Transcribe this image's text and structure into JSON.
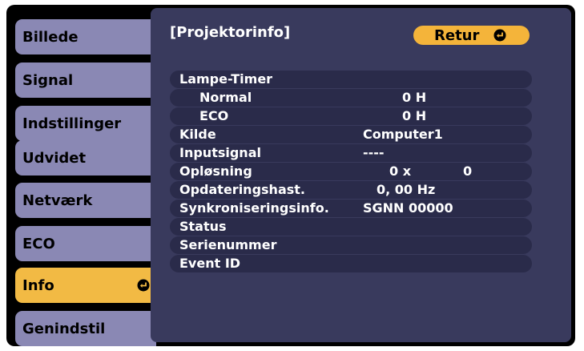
{
  "menu": {
    "items": [
      {
        "label": "Billede"
      },
      {
        "label": "Signal"
      },
      {
        "label": "Indstillinger"
      },
      {
        "label": "Udvidet"
      },
      {
        "label": "Netværk"
      },
      {
        "label": "ECO"
      },
      {
        "label": "Info",
        "selected": true
      },
      {
        "label": "Genindstil"
      }
    ],
    "selected_color": "#f2ba44",
    "tab_color": "#8a88b4"
  },
  "panel": {
    "title": "[Projektorinfo]",
    "return_label": "Retur",
    "return_icon": "enter-icon",
    "background": "#393a5d",
    "rows": [
      {
        "label": "Lampe-Timer",
        "value": "",
        "value2": ""
      },
      {
        "label": "Normal",
        "value": "0 H",
        "value2": ""
      },
      {
        "label": "ECO",
        "value": "0 H",
        "value2": ""
      },
      {
        "label": "Kilde",
        "value": "Computer1",
        "value2": ""
      },
      {
        "label": "Inputsignal",
        "value": "----",
        "value2": ""
      },
      {
        "label": "Opløsning",
        "value": "0 x",
        "value2": "0"
      },
      {
        "label": "Opdateringshast.",
        "value": "0, 00 Hz",
        "value2": ""
      },
      {
        "label": "Synkroniseringsinfo.",
        "value": "SGNN 00000",
        "value2": ""
      },
      {
        "label": "Status",
        "value": "",
        "value2": ""
      },
      {
        "label": "Serienummer",
        "value": "",
        "value2": ""
      },
      {
        "label": "Event ID",
        "value": "",
        "value2": ""
      }
    ]
  }
}
